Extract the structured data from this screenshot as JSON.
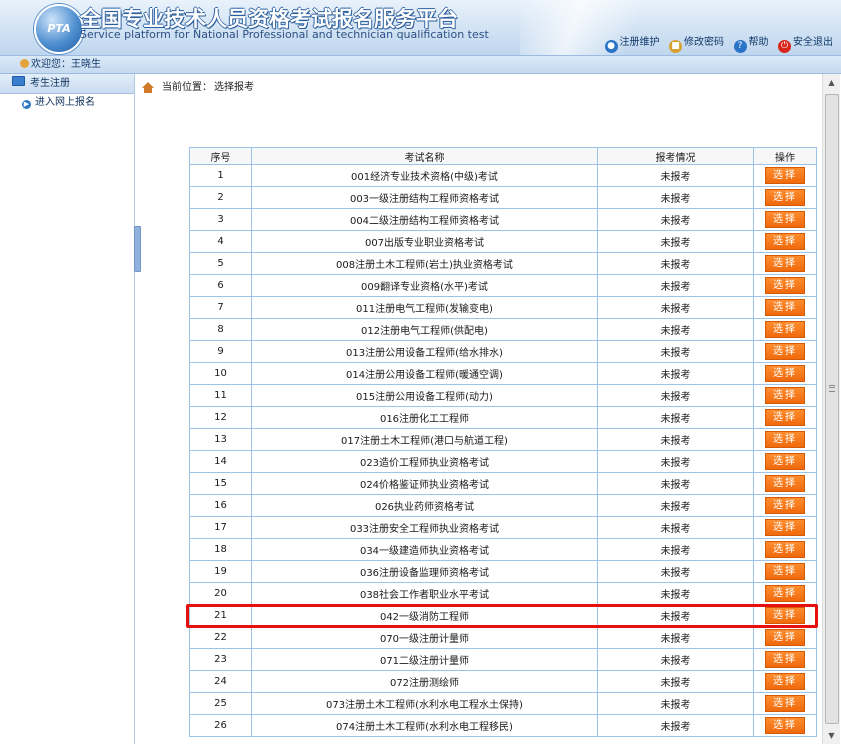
{
  "header": {
    "logo_text": "PTA",
    "title_cn": "全国专业技术人员资格考试报名服务平台",
    "title_en": "Service platform for National Professional and technician qualification test",
    "tools": [
      {
        "label": "注册维护",
        "icon": "globe-icon",
        "color": "#2a74c8"
      },
      {
        "label": "修改密码",
        "icon": "user-lock-icon",
        "color": "#d8a130"
      },
      {
        "label": "帮助",
        "icon": "help-icon",
        "color": "#2a74c8"
      },
      {
        "label": "安全退出",
        "icon": "power-icon",
        "color": "#d8261c"
      }
    ]
  },
  "welcome": {
    "text": "欢迎您：王晓生"
  },
  "sidebar": {
    "header": "考生注册",
    "items": [
      {
        "label": "进入网上报名"
      }
    ]
  },
  "location": {
    "label": "当前位置：",
    "value": "选择报考"
  },
  "table": {
    "headers": [
      "序号",
      "考试名称",
      "报考情况",
      "操作"
    ],
    "button_label": "选择",
    "highlight_row": "21",
    "rows": [
      {
        "no": "1",
        "name": "001经济专业技术资格(中级)考试",
        "status": "未报考"
      },
      {
        "no": "2",
        "name": "003一级注册结构工程师资格考试",
        "status": "未报考"
      },
      {
        "no": "3",
        "name": "004二级注册结构工程师资格考试",
        "status": "未报考"
      },
      {
        "no": "4",
        "name": "007出版专业职业资格考试",
        "status": "未报考"
      },
      {
        "no": "5",
        "name": "008注册土木工程师(岩土)执业资格考试",
        "status": "未报考"
      },
      {
        "no": "6",
        "name": "009翻译专业资格(水平)考试",
        "status": "未报考"
      },
      {
        "no": "7",
        "name": "011注册电气工程师(发输变电)",
        "status": "未报考"
      },
      {
        "no": "8",
        "name": "012注册电气工程师(供配电)",
        "status": "未报考"
      },
      {
        "no": "9",
        "name": "013注册公用设备工程师(给水排水)",
        "status": "未报考"
      },
      {
        "no": "10",
        "name": "014注册公用设备工程师(暖通空调)",
        "status": "未报考"
      },
      {
        "no": "11",
        "name": "015注册公用设备工程师(动力)",
        "status": "未报考"
      },
      {
        "no": "12",
        "name": "016注册化工工程师",
        "status": "未报考"
      },
      {
        "no": "13",
        "name": "017注册土木工程师(港口与航道工程)",
        "status": "未报考"
      },
      {
        "no": "14",
        "name": "023造价工程师执业资格考试",
        "status": "未报考"
      },
      {
        "no": "15",
        "name": "024价格鉴证师执业资格考试",
        "status": "未报考"
      },
      {
        "no": "16",
        "name": "026执业药师资格考试",
        "status": "未报考"
      },
      {
        "no": "17",
        "name": "033注册安全工程师执业资格考试",
        "status": "未报考"
      },
      {
        "no": "18",
        "name": "034一级建造师执业资格考试",
        "status": "未报考"
      },
      {
        "no": "19",
        "name": "036注册设备监理师资格考试",
        "status": "未报考"
      },
      {
        "no": "20",
        "name": "038社会工作者职业水平考试",
        "status": "未报考"
      },
      {
        "no": "21",
        "name": "042一级消防工程师",
        "status": "未报考"
      },
      {
        "no": "22",
        "name": "070一级注册计量师",
        "status": "未报考"
      },
      {
        "no": "23",
        "name": "071二级注册计量师",
        "status": "未报考"
      },
      {
        "no": "24",
        "name": "072注册测绘师",
        "status": "未报考"
      },
      {
        "no": "25",
        "name": "073注册土木工程师(水利水电工程水土保持)",
        "status": "未报考"
      },
      {
        "no": "26",
        "name": "074注册土木工程师(水利水电工程移民)",
        "status": "未报考"
      }
    ]
  }
}
